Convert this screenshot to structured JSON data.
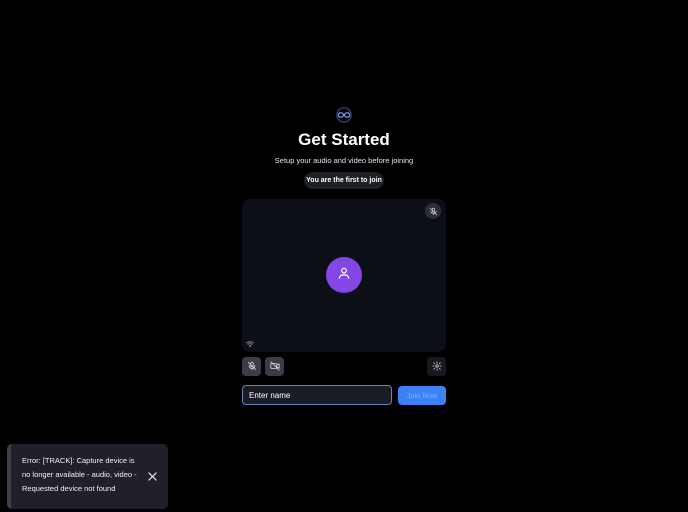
{
  "header": {
    "logo_icon": "infinity-logo-icon",
    "title": "Get Started",
    "subtitle": "Setup your audio and video before joining",
    "participant_status": "You are the first to join"
  },
  "preview": {
    "mic_status_icon": "mic-off-icon",
    "avatar_icon": "user-icon",
    "network_icon": "wifi-icon",
    "avatar_color": "#8447e6"
  },
  "controls": {
    "mic_icon": "mic-off-icon",
    "camera_icon": "video-off-icon",
    "settings_icon": "gear-icon"
  },
  "join": {
    "name_placeholder": "Enter name",
    "name_value": "",
    "join_label": "Join Now",
    "accent_color": "#3b82f6"
  },
  "toast": {
    "message": "Error: [TRACK]: Capture device is no longer available - audio, video - Requested device not found",
    "close_icon": "close-icon"
  }
}
